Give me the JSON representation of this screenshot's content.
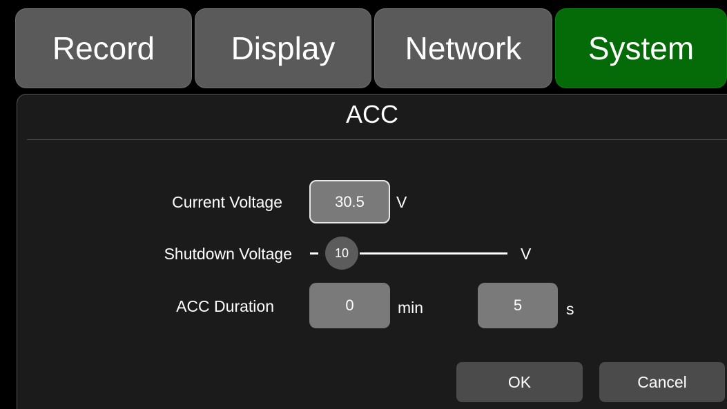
{
  "tabs": [
    {
      "label": "Record"
    },
    {
      "label": "Display"
    },
    {
      "label": "Network"
    },
    {
      "label": "System"
    }
  ],
  "active_tab": "System",
  "panel": {
    "title": "ACC"
  },
  "current_voltage": {
    "label": "Current Voltage",
    "value": "30.5",
    "unit": "V"
  },
  "shutdown_voltage": {
    "label": "Shutdown Voltage",
    "value": "10",
    "unit": "V"
  },
  "acc_duration": {
    "label": "ACC Duration",
    "minutes": "0",
    "minutes_unit": "min",
    "seconds": "5",
    "seconds_unit": "s"
  },
  "buttons": {
    "ok": "OK",
    "cancel": "Cancel"
  },
  "colors": {
    "active_tab": "#046b08",
    "tab": "#5a5a5a",
    "panel": "#1b1b1b",
    "field": "#7a7a7a",
    "button": "#4b4b4b"
  }
}
